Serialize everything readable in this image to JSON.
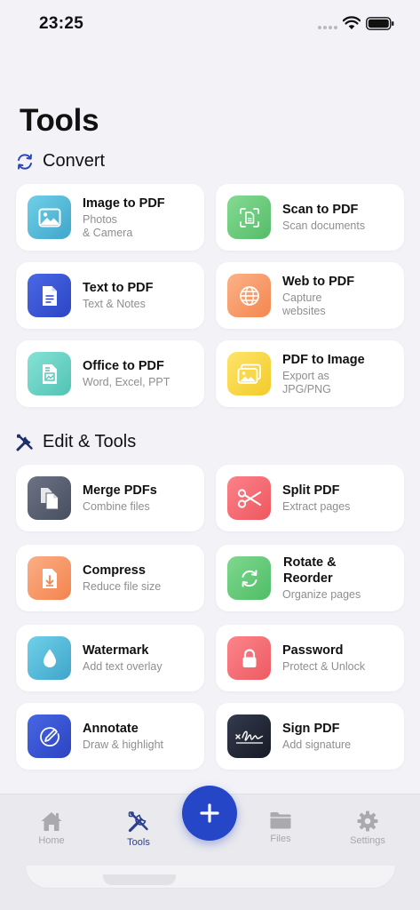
{
  "status_bar": {
    "time": "23:25"
  },
  "page_title": "Tools",
  "sections": {
    "convert": "Convert",
    "edit_tools": "Edit & Tools"
  },
  "cards": {
    "image_to_pdf": {
      "title": "Image to PDF",
      "subtitle": "  Photos\n& Camera",
      "color": "#5bbfd9"
    },
    "scan_to_pdf": {
      "title": "Scan to PDF",
      "subtitle": "Scan documents",
      "color": "#6fcf7f"
    },
    "text_to_pdf": {
      "title": "Text to PDF",
      "subtitle": "Text & Notes",
      "color": "#3a57d6"
    },
    "web_to_pdf": {
      "title": "Web to PDF",
      "subtitle": "Capture\nwebsites",
      "color": "#f79c6e"
    },
    "office_to_pdf": {
      "title": "Office to PDF",
      "subtitle": "Word, Excel, PPT",
      "color": "#6bd6c8"
    },
    "pdf_to_image": {
      "title": "PDF to Image",
      "subtitle": "Export as\nJPG/PNG",
      "color": "#f8d84a"
    },
    "merge_pdfs": {
      "title": "Merge PDFs",
      "subtitle": "Combine files",
      "color": "#5b6272"
    },
    "split_pdf": {
      "title": "Split PDF",
      "subtitle": "Extract pages",
      "color": "#f66b73"
    },
    "compress": {
      "title": "Compress",
      "subtitle": "Reduce file size",
      "color": "#f89a6b"
    },
    "rotate_reorder": {
      "title": "Rotate &\nReorder",
      "subtitle": "Organize pages",
      "color": "#68c97a"
    },
    "watermark": {
      "title": "Watermark",
      "subtitle": "Add text overlay",
      "color": "#54bcd8"
    },
    "password": {
      "title": "Password",
      "subtitle": "Protect & Unlock",
      "color": "#f46c72"
    },
    "annotate": {
      "title": "Annotate",
      "subtitle": "Draw & highlight",
      "color": "#3853d4"
    },
    "sign_pdf": {
      "title": "Sign PDF",
      "subtitle": "Add signature",
      "color": "#222838"
    }
  },
  "tabbar": {
    "home": "Home",
    "tools": "Tools",
    "files": "Files",
    "settings": "Settings",
    "active": "tools",
    "accent": "#2547c7"
  }
}
